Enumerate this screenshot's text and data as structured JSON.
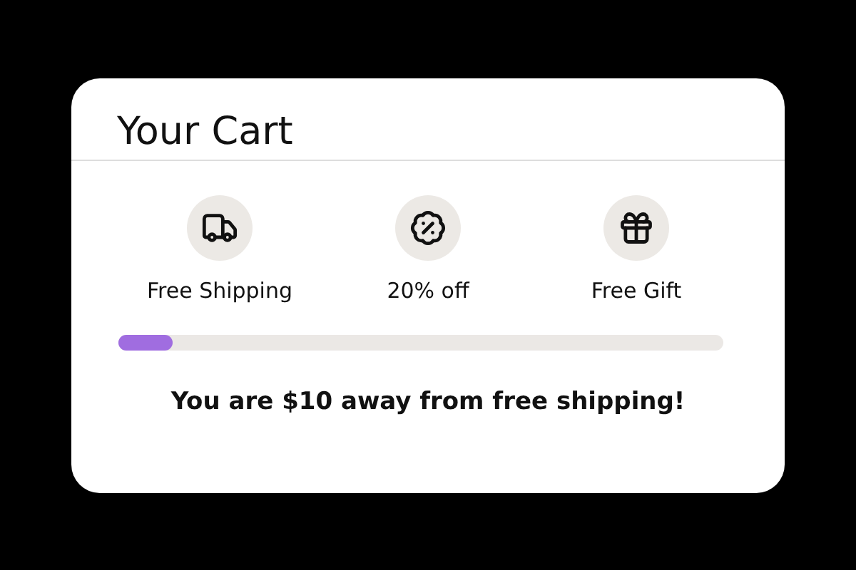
{
  "cart": {
    "title": "Your Cart",
    "rewards": [
      {
        "kind": "truck",
        "label": "Free Shipping"
      },
      {
        "kind": "discount",
        "label": "20% off"
      },
      {
        "kind": "gift",
        "label": "Free Gift"
      }
    ],
    "progress": {
      "level": 0.09
    },
    "message": "You are $10 away from free shipping!"
  }
}
